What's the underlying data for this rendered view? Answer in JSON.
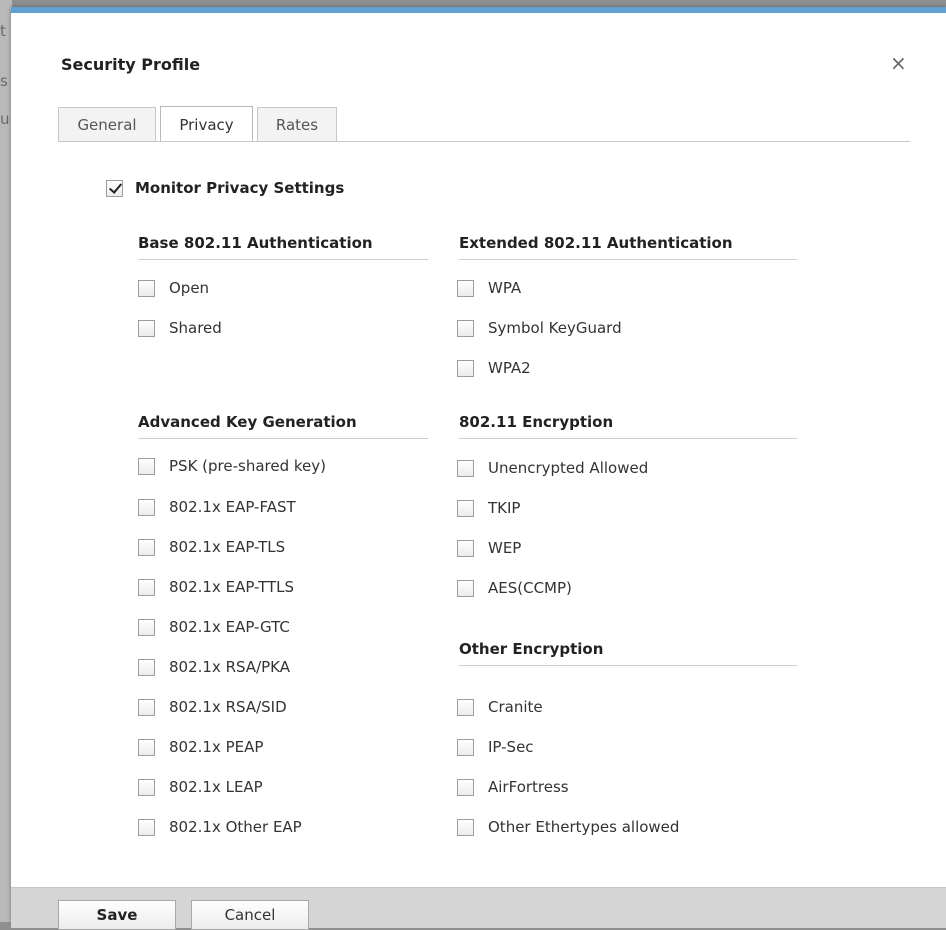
{
  "dialog": {
    "title": "Security Profile",
    "close_glyph": "×"
  },
  "tabs": [
    {
      "label": "General",
      "active": false
    },
    {
      "label": "Privacy",
      "active": true
    },
    {
      "label": "Rates",
      "active": false
    }
  ],
  "monitor": {
    "label": "Monitor Privacy Settings",
    "checked": true
  },
  "sections": {
    "base_auth": {
      "title": "Base 802.11 Authentication",
      "items": [
        "Open",
        "Shared"
      ]
    },
    "ext_auth": {
      "title": "Extended 802.11 Authentication",
      "items": [
        "WPA",
        "Symbol KeyGuard",
        "WPA2"
      ]
    },
    "adv_key": {
      "title": "Advanced Key Generation",
      "items": [
        "PSK (pre-shared key)",
        "802.1x EAP-FAST",
        "802.1x EAP-TLS",
        "802.1x EAP-TTLS",
        "802.1x EAP-GTC",
        "802.1x RSA/PKA",
        "802.1x RSA/SID",
        "802.1x PEAP",
        "802.1x LEAP",
        "802.1x Other EAP"
      ]
    },
    "encryption": {
      "title": "802.11 Encryption",
      "items": [
        "Unencrypted Allowed",
        "TKIP",
        "WEP",
        "AES(CCMP)"
      ]
    },
    "other_enc": {
      "title": "Other Encryption",
      "items": [
        "Cranite",
        "IP-Sec",
        "AirFortress",
        "Other Ethertypes allowed"
      ]
    }
  },
  "footer": {
    "save_label": "Save",
    "cancel_label": "Cancel"
  },
  "colors": {
    "accent": "#5ea1d2",
    "footer_bg": "#d5d5d5"
  }
}
